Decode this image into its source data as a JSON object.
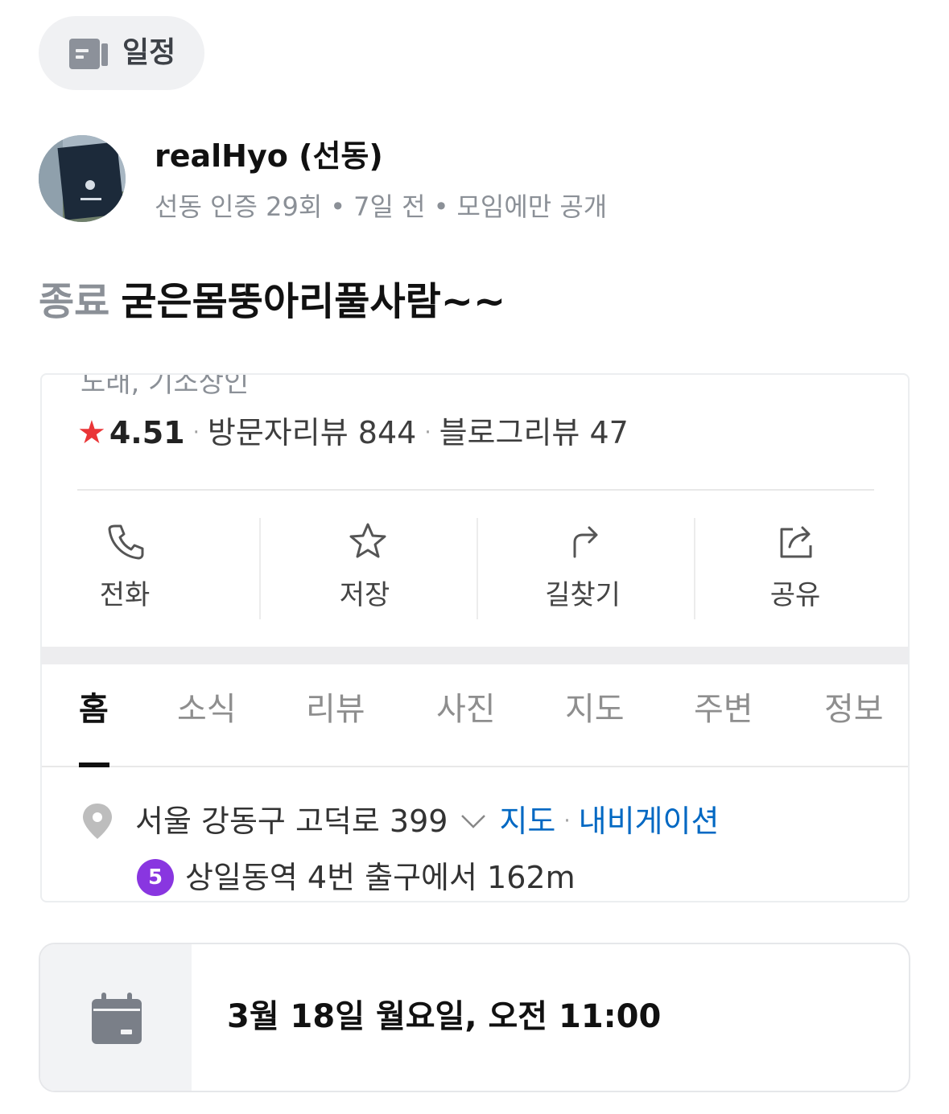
{
  "chip": {
    "icon": "schedule-icon",
    "label": "일정"
  },
  "author": {
    "avatar_icon": "profile-photo",
    "name": "realHyo (선동)",
    "verification": "선동 인증 29회",
    "time": "7일 전",
    "visibility": "모임에만 공개",
    "separator": "•"
  },
  "post": {
    "status": "종료",
    "title": "굳은몸뚱아리풀사람~~"
  },
  "place_screenshot": {
    "cut_text": "노래, 기소상인",
    "rating": {
      "star": "★",
      "score": "4.51",
      "separator": "·",
      "visitor_reviews": "방문자리뷰 844",
      "blog_reviews": "블로그리뷰 47"
    },
    "actions": [
      {
        "icon": "phone-icon",
        "label": "전화"
      },
      {
        "icon": "star-icon",
        "label": "저장"
      },
      {
        "icon": "directions-icon",
        "label": "길찾기"
      },
      {
        "icon": "share-icon",
        "label": "공유"
      }
    ],
    "tabs": [
      "홈",
      "소식",
      "리뷰",
      "사진",
      "지도",
      "주변",
      "정보"
    ],
    "active_tab": "홈",
    "address": "서울 강동구 고덕로 399",
    "map_link": "지도",
    "link_separator": "·",
    "navigation_link": "내비게이션",
    "subway_line": "5",
    "subway_text": "상일동역 4번 출구에서 162m",
    "colors": {
      "star": "#ea3537",
      "link": "#0068c3",
      "subway_line": "#8936e0"
    }
  },
  "schedule": {
    "icon": "calendar-icon",
    "datetime": "3월 18일 월요일, 오전 11:00"
  }
}
